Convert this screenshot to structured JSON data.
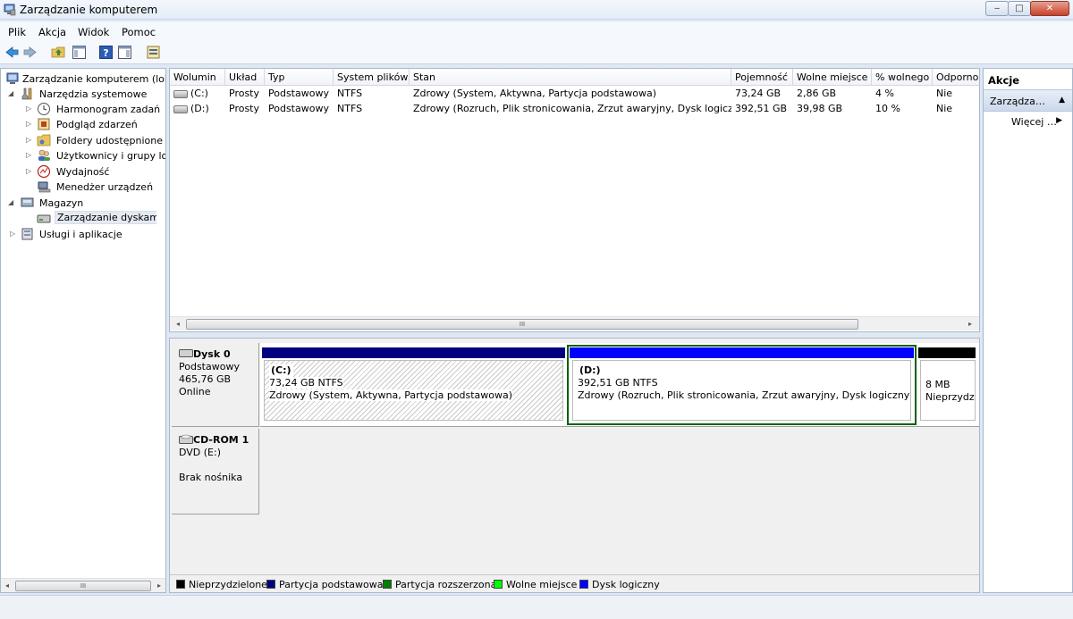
{
  "window": {
    "title": "Zarządzanie komputerem",
    "btn_min": "‒",
    "btn_max": "□",
    "btn_close": "✕"
  },
  "menu": [
    "Plik",
    "Akcja",
    "Widok",
    "Pomoc"
  ],
  "toolbar": {
    "icons": [
      "back-arrow-icon",
      "forward-arrow-icon",
      "up-folder-icon",
      "show-hide-tree-icon",
      "help-icon",
      "action-pane-icon",
      "properties-icon"
    ],
    "back": "◀",
    "forward": "▶",
    "help": "?"
  },
  "tree": {
    "root": "Zarządzanie komputerem (lokalne)",
    "system_tools": "Narzędzia systemowe",
    "task_scheduler": "Harmonogram zadań",
    "event_viewer": "Podgląd zdarzeń",
    "shared_folders": "Foldery udostępnione",
    "local_users": "Użytkownicy i grupy lokalne",
    "performance": "Wydajność",
    "device_manager": "Menedżer urządzeń",
    "storage": "Magazyn",
    "disk_management": "Zarządzanie dyskami",
    "services": "Usługi i aplikacje",
    "expander_open": "◢",
    "expander_closed": "▷"
  },
  "scroll": {
    "left": "◂",
    "right": "▸",
    "grip": "III"
  },
  "volumes": {
    "columns": [
      "Wolumin",
      "Układ",
      "Typ",
      "System plików",
      "Stan",
      "Pojemność",
      "Wolne miejsce",
      "% wolnego",
      "Odporność"
    ],
    "rows": [
      [
        "(C:)",
        "Prosty",
        "Podstawowy",
        "NTFS",
        "Zdrowy (System, Aktywna, Partycja podstawowa)",
        "73,24 GB",
        "2,86 GB",
        "4 %",
        "Nie"
      ],
      [
        "(D:)",
        "Prosty",
        "Podstawowy",
        "NTFS",
        "Zdrowy (Rozruch, Plik stronicowania, Zrzut awaryjny, Dysk logiczny)",
        "392,51 GB",
        "39,98 GB",
        "10 %",
        "Nie"
      ]
    ]
  },
  "disks": {
    "disk0": {
      "name": "Dysk 0",
      "type": "Podstawowy",
      "size": "465,76 GB",
      "status": "Online"
    },
    "cdrom": {
      "name": "CD-ROM 1",
      "drive": "DVD (E:)",
      "status": "Brak nośnika"
    },
    "part_c": {
      "name": "(C:)",
      "size": "73,24 GB NTFS",
      "status": "Zdrowy (System, Aktywna, Partycja podstawowa)"
    },
    "part_d": {
      "name": "(D:)",
      "size": "392,51 GB NTFS",
      "status": "Zdrowy (Rozruch, Plik stronicowania, Zrzut awaryjny, Dysk logiczny)"
    },
    "unalloc": {
      "size": "8 MB",
      "status": "Nieprzydzielone"
    }
  },
  "legend": [
    {
      "label": "Nieprzydzielone",
      "color": "#000000"
    },
    {
      "label": "Partycja podstawowa",
      "color": "#000080"
    },
    {
      "label": "Partycja rozszerzona",
      "color": "#008000"
    },
    {
      "label": "Wolne miejsce",
      "color": "#00ff00"
    },
    {
      "label": "Dysk logiczny",
      "color": "#0000ff"
    }
  ],
  "actions": {
    "title": "Akcje",
    "section": "Zarządzanie dyskami",
    "more": "Więcej akcji",
    "collapse": "▲",
    "more_arrow": "▶"
  }
}
